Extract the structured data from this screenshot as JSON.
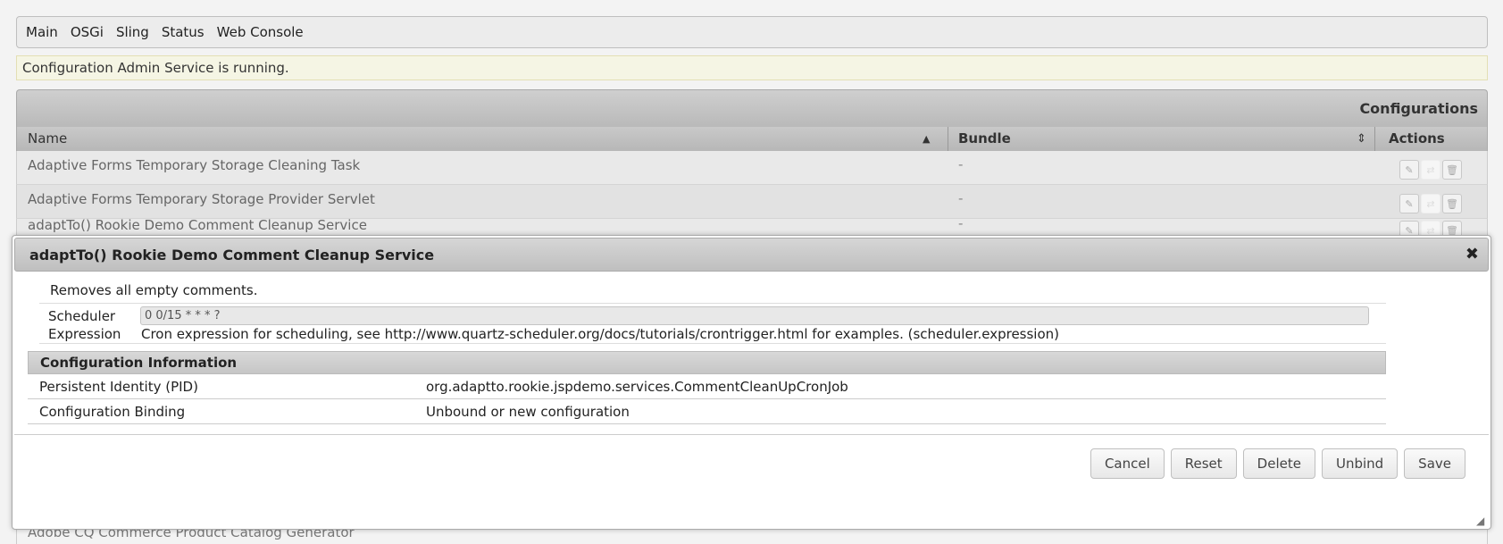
{
  "menu": [
    "Main",
    "OSGi",
    "Sling",
    "Status",
    "Web Console"
  ],
  "status_message": "Configuration Admin Service is running.",
  "configurations": {
    "title": "Configurations",
    "columns": {
      "name": "Name",
      "bundle": "Bundle",
      "actions": "Actions"
    },
    "rows": [
      {
        "name": "Adaptive Forms Temporary Storage Cleaning Task",
        "bundle": "-"
      },
      {
        "name": "Adaptive Forms Temporary Storage Provider Servlet",
        "bundle": "-"
      },
      {
        "name": "adaptTo() Rookie Demo Comment Cleanup Service",
        "bundle": "-"
      }
    ],
    "partial_row_name": "Adobe CQ Commerce Product Catalog Generator"
  },
  "dialog": {
    "title": "adaptTo() Rookie Demo Comment Cleanup Service",
    "close_glyph": "✖",
    "description": "Removes all empty comments.",
    "scheduler": {
      "label_line1": "Scheduler",
      "label_line2": "Expression",
      "value": "0 0/15 * * * ?",
      "help": "Cron expression for scheduling, see http://www.quartz-scheduler.org/docs/tutorials/crontrigger.html for examples. (scheduler.expression)"
    },
    "info_header": "Configuration Information",
    "info": [
      {
        "key": "Persistent Identity (PID)",
        "value": "org.adaptto.rookie.jspdemo.services.CommentCleanUpCronJob"
      },
      {
        "key": "Configuration Binding",
        "value": "Unbound or new configuration"
      }
    ],
    "buttons": {
      "cancel": "Cancel",
      "reset": "Reset",
      "delete": "Delete",
      "unbind": "Unbind",
      "save": "Save"
    }
  },
  "icons": {
    "edit": "edit-icon",
    "unbind": "unbind-icon",
    "delete": "trash-icon",
    "sort_asc": "sort-ascending-icon",
    "sort_both": "sort-icon",
    "resize": "resize-grip-icon"
  },
  "colors": {
    "status_bg": "#f5f5e4",
    "header_bg": "#bfbfbf",
    "dialog_bg": "#ffffff"
  }
}
